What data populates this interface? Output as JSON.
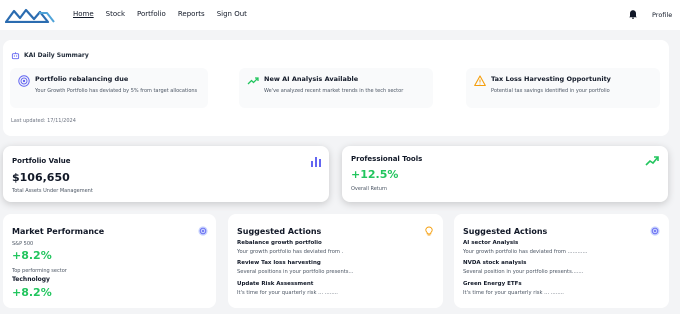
{
  "nav": {
    "items": [
      "Home",
      "Stock",
      "Portfolio",
      "Reports",
      "Sign Out"
    ],
    "active": "Home",
    "profile": "Profile"
  },
  "summary": {
    "title": "KAI Daily Summary",
    "alerts": [
      {
        "icon": "target-icon",
        "title": "Portfolio rebalancing due",
        "desc": "Your Growth Portfolio has deviated by 5% from target allocations"
      },
      {
        "icon": "trend-up-icon",
        "title": "New AI Analysis Available",
        "desc": "We've analyzed recent market trends in the tech sector"
      },
      {
        "icon": "warning-icon",
        "title": "Tax Loss Harvesting Opportunity",
        "desc": "Potential tax savings identified in your portfolio"
      }
    ],
    "last_updated": "Last updated: 17/11/2024"
  },
  "stats": {
    "portfolio": {
      "title": "Portfolio Value",
      "value": "$106,650",
      "sub": "Total Assets Under Management"
    },
    "tools": {
      "title": "Professional Tools",
      "value": "+12.5%",
      "sub": "Overall Return"
    }
  },
  "market": {
    "title": "Market Performance",
    "index_label": "S&P 500",
    "index_value": "+8.2%",
    "sector_label": "Top performing sector",
    "sector_name": "Technology",
    "sector_value": "+8.2%"
  },
  "suggested_a": {
    "title": "Suggested Actions",
    "items": [
      {
        "title": "Rebalance growth portfolio",
        "desc": "Your growth portfolio has deviated from ."
      },
      {
        "title": "Review Tax loss harvesting",
        "desc": "Several positions in your portfolio presents..."
      },
      {
        "title": "Update Risk Assessment",
        "desc": "It's time for your quarterly risk ... ........"
      }
    ]
  },
  "suggested_b": {
    "title": "Suggested Actions",
    "items": [
      {
        "title": "AI sector Analysis",
        "desc": "Your growth portfolio has deviated from ............"
      },
      {
        "title": "NVDA stock analysis",
        "desc": "Several position in your portfolio presents......."
      },
      {
        "title": "Green Energy ETFs",
        "desc": "It's time for your quarterly risk ... ........"
      }
    ]
  },
  "colors": {
    "accent": "#3b82f6",
    "positive": "#22c55e",
    "purple": "#6366f1",
    "warning": "#f59e0b"
  }
}
